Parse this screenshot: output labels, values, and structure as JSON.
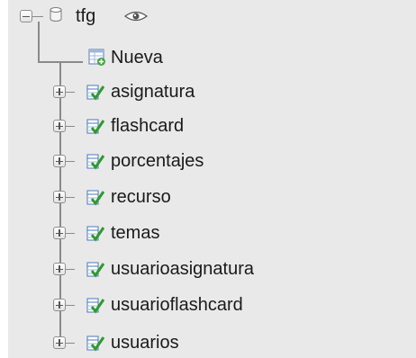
{
  "database": {
    "name": "tfg",
    "icon": "database-icon",
    "visibility_icon": "eye-icon",
    "expanded": true
  },
  "new_item": {
    "label": "Nueva",
    "icon": "new-table-icon"
  },
  "tables": [
    {
      "label": "asignatura",
      "icon": "table-icon",
      "expanded": false
    },
    {
      "label": "flashcard",
      "icon": "table-icon",
      "expanded": false
    },
    {
      "label": "porcentajes",
      "icon": "table-icon",
      "expanded": false
    },
    {
      "label": "recurso",
      "icon": "table-icon",
      "expanded": false
    },
    {
      "label": "temas",
      "icon": "table-icon",
      "expanded": false
    },
    {
      "label": "usuarioasignatura",
      "icon": "table-icon",
      "expanded": false
    },
    {
      "label": "usuarioflashcard",
      "icon": "table-icon",
      "expanded": false
    },
    {
      "label": "usuarios",
      "icon": "table-icon",
      "expanded": false
    }
  ],
  "colors": {
    "panel_background": "#e9e9e9",
    "text": "#1a1a1a",
    "tree_line": "#8a8a8a",
    "table_icon_green": "#2e9a2e",
    "table_icon_blue": "#4a78b8"
  }
}
